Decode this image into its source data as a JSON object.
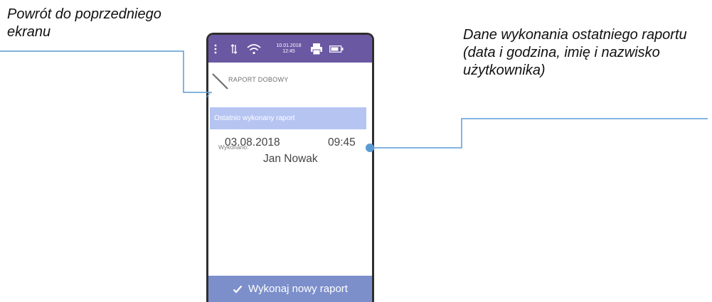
{
  "annotations": {
    "left": "Powrót do poprzedniego ekranu",
    "right": "Dane wykonania ostatniego raportu (data i godzina, imię i nazwisko użytkownika)"
  },
  "statusbar": {
    "date": "10.01.2018",
    "time": "12:45",
    "icons": [
      "menu-dots-icon",
      "data-transfer-icon",
      "wifi-icon",
      "printer-icon",
      "battery-icon"
    ]
  },
  "header": {
    "title": "RAPORT DOBOWY",
    "back_icon": "back-arrow-icon"
  },
  "section": {
    "title": "Ostatnio wykonany raport"
  },
  "report": {
    "label": "Wykonano:",
    "date": "03.08.2018",
    "time": "09:45",
    "user": "Jan Nowak"
  },
  "action": {
    "label": "Wykonaj nowy raport",
    "icon": "check-icon"
  },
  "colors": {
    "statusbar": "#6a58a2",
    "section_band": "#b6c4f2",
    "action_button": "#7c8fcb",
    "callout_line": "#5b9bd5"
  }
}
